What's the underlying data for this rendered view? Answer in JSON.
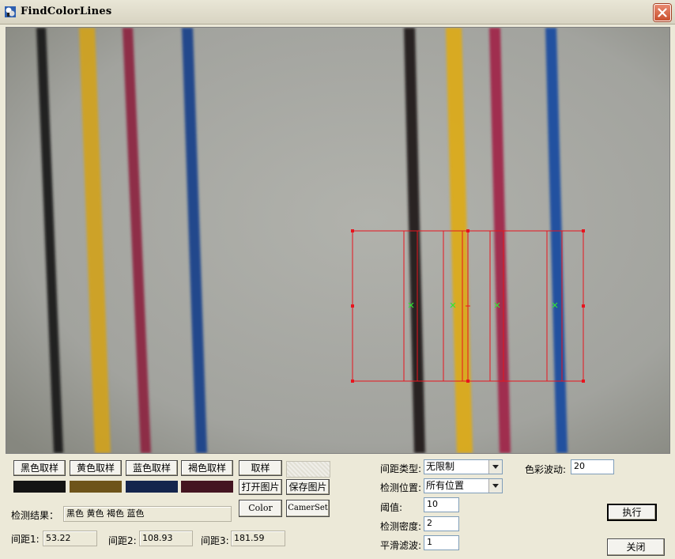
{
  "window": {
    "title": "FindColorLines"
  },
  "toolbar": {
    "sample_buttons": [
      "黑色取样",
      "黄色取样",
      "蓝色取样",
      "褐色取样"
    ],
    "sample_btn": "取样",
    "open_image": "打开图片",
    "save_image": "保存图片",
    "color_btn": "Color",
    "camera_btn": "CamerSet"
  },
  "swatch_colors": [
    "#141414",
    "#6e541a",
    "#14254d",
    "#441521"
  ],
  "result": {
    "label": "检测结果：",
    "value": "黑色  黄色  褐色  蓝色"
  },
  "distances": [
    {
      "label": "间距1:",
      "value": "53.22"
    },
    {
      "label": "间距2:",
      "value": "108.93"
    },
    {
      "label": "间距3:",
      "value": "181.59"
    }
  ],
  "settings": {
    "spacing_type_label": "间距类型:",
    "spacing_type_value": "无限制",
    "detect_position_label": "检测位置:",
    "detect_position_value": "所有位置",
    "threshold_label": "阈值:",
    "threshold_value": "10",
    "density_label": "检测密度:",
    "density_value": "2",
    "smoothing_label": "平滑滤波:",
    "smoothing_value": "1",
    "color_fluct_label": "色彩波动:",
    "color_fluct_value": "20"
  },
  "actions": {
    "execute": "执行",
    "close": "关闭"
  },
  "image": {
    "background": "#a7a8a3",
    "stripe_colors": [
      "#1a1817",
      "#d0a21c",
      "#8c2440",
      "#18418a",
      "#1e1a1a",
      "#dcaa18",
      "#a02448",
      "#1a4aa0"
    ],
    "roi_color": "#e8141e",
    "marker_color": "#32e632"
  }
}
